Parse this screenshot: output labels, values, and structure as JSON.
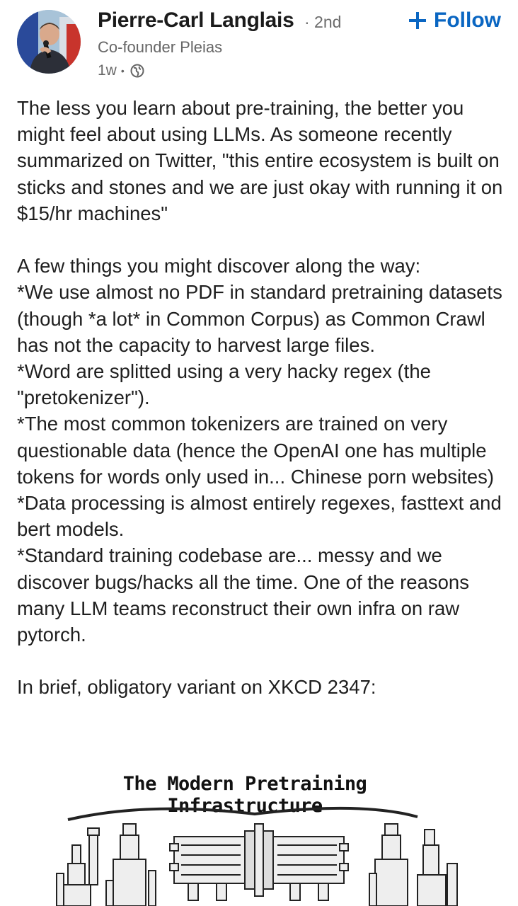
{
  "author": {
    "name": "Pierre-Carl Langlais",
    "degree": "· 2nd",
    "headline": "Co-founder Pleias",
    "time": "1w",
    "time_separator": "•",
    "visibility_icon": "globe-icon"
  },
  "follow": {
    "label": "Follow",
    "icon": "plus-icon",
    "color": "#0a66c2"
  },
  "post": {
    "paragraphs": [
      "The less you learn about pre-training, the better you might feel about using LLMs. As someone recently summarized on Twitter, \"this entire ecosystem is built on sticks and stones and we are just okay with running it on $15/hr machines\"",
      "",
      "A few things you might discover along the way:",
      "*We use almost no PDF in standard pretraining datasets (though *a lot* in Common Corpus) as Common Crawl has not the capacity to harvest large files.",
      "*Word are splitted using a very hacky regex (the \"pretokenizer\").",
      "*The most common tokenizers are trained on very questionable data (hence the OpenAI one has multiple tokens for words only used in... Chinese porn websites)",
      "*Data processing is almost entirely regexes, fasttext and bert models.",
      "*Standard training codebase are... messy and we discover bugs/hacks all the time. One of the reasons many LLM teams reconstruct their own infra on raw pytorch.",
      "",
      "In brief, obligatory variant on XKCD 2347:"
    ]
  },
  "image": {
    "title": "The Modern Pretraining Infrastructure"
  }
}
